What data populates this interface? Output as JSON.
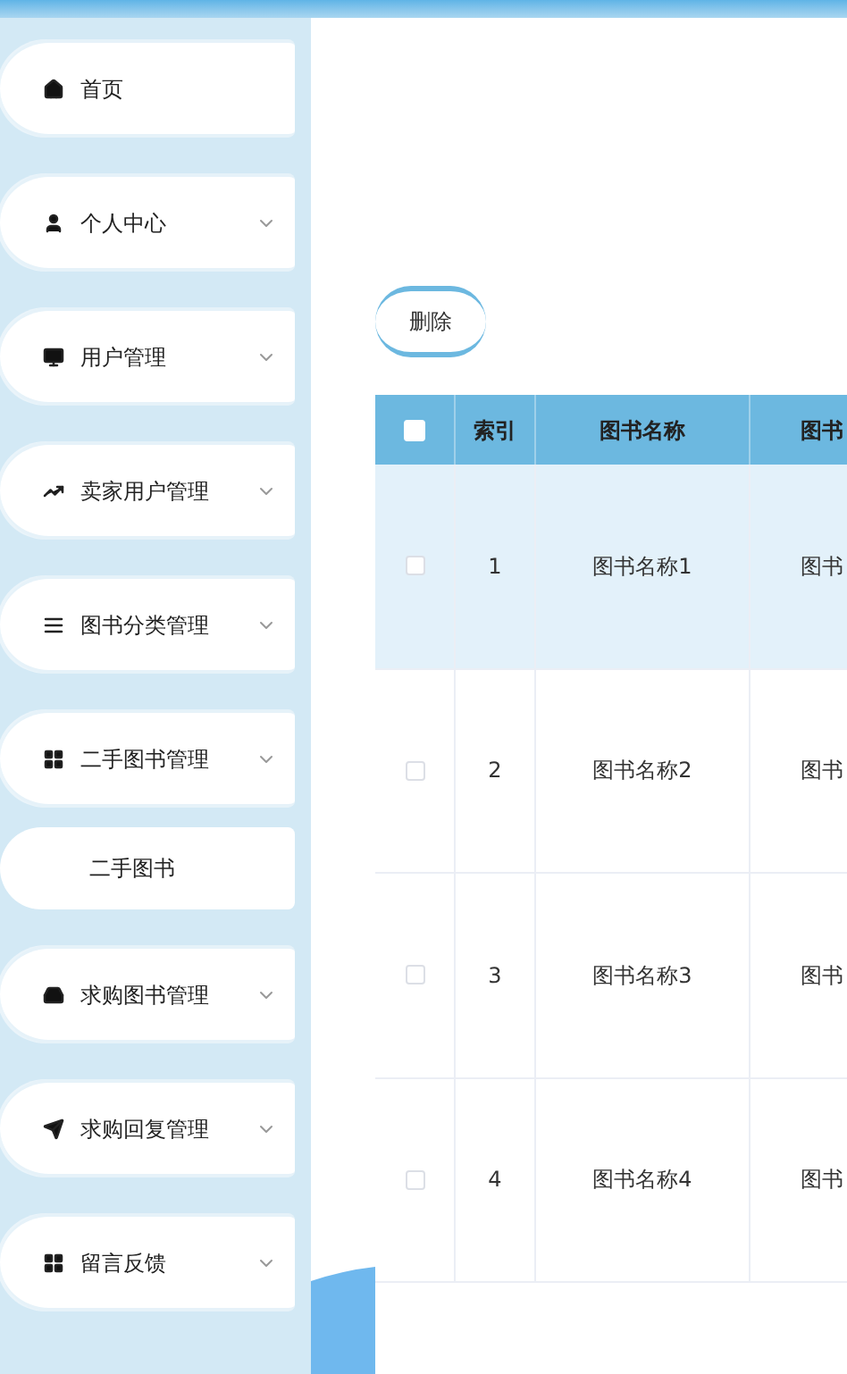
{
  "sidebar": {
    "items": [
      {
        "label": "首页",
        "kind": "link"
      },
      {
        "label": "个人中心",
        "kind": "submenu"
      },
      {
        "label": "用户管理",
        "kind": "submenu"
      },
      {
        "label": "卖家用户管理",
        "kind": "submenu"
      },
      {
        "label": "图书分类管理",
        "kind": "submenu"
      },
      {
        "label": "二手图书管理",
        "kind": "submenu",
        "children": [
          {
            "label": "二手图书"
          }
        ]
      },
      {
        "label": "求购图书管理",
        "kind": "submenu"
      },
      {
        "label": "求购回复管理",
        "kind": "submenu"
      },
      {
        "label": "留言反馈",
        "kind": "submenu"
      }
    ]
  },
  "toolbar": {
    "buttons": [
      "删除"
    ]
  },
  "table": {
    "header_checkbox": {
      "checked": false
    },
    "columns": [
      "索引",
      "图书名称",
      "图书"
    ],
    "rows": [
      {
        "checked": false,
        "highlighted": true,
        "cells": [
          "1",
          "图书名称1",
          "图书"
        ]
      },
      {
        "checked": false,
        "highlighted": false,
        "cells": [
          "2",
          "图书名称2",
          "图书"
        ]
      },
      {
        "checked": false,
        "highlighted": false,
        "cells": [
          "3",
          "图书名称3",
          "图书"
        ]
      },
      {
        "checked": false,
        "highlighted": false,
        "cells": [
          "4",
          "图书名称4",
          "图书"
        ]
      }
    ]
  }
}
